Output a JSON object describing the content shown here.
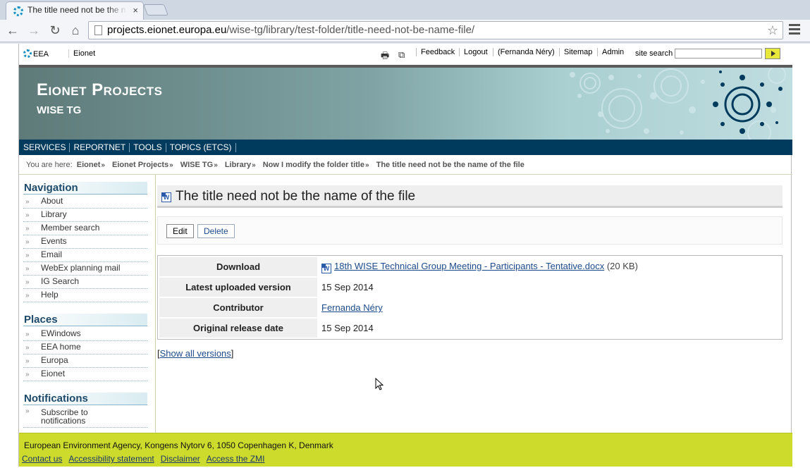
{
  "browser": {
    "tab_title": "The title need not be the n",
    "tab_close": "×",
    "url_host": "projects.eionet.europa.eu",
    "url_path": "/wise-tg/library/test-folder/title-need-not-be-name-file/",
    "back_glyph": "←",
    "forward_glyph": "→",
    "reload_glyph": "↻",
    "home_glyph": "⌂",
    "star_glyph": "☆"
  },
  "ribbon": {
    "eea": "EEA",
    "eionet": "Eionet",
    "print_glyph": "🖶",
    "fullscreen_glyph": "⧉",
    "feedback": "Feedback",
    "logout": "Logout",
    "user": "(Fernanda Néry)",
    "sitemap": "Sitemap",
    "admin": "Admin",
    "search_label": "site search"
  },
  "banner": {
    "title": "Eionet Projects",
    "subtitle": "WISE TG"
  },
  "mainnav": [
    "SERVICES",
    "REPORTNET",
    "TOOLS",
    "TOPICS (ETCS)"
  ],
  "breadcrumb": {
    "prefix": "You are here:",
    "items": [
      "Eionet",
      "Eionet Projects",
      "WISE TG",
      "Library",
      "Now I modify the folder title",
      "The title need not be the name of the file"
    ],
    "sep": "»"
  },
  "navigation": {
    "title": "Navigation",
    "items": [
      "About",
      "Library",
      "Member search",
      "Events",
      "Email",
      "WebEx planning mail",
      "IG Search",
      "Help"
    ]
  },
  "places": {
    "title": "Places",
    "items": [
      "EWindows",
      "EEA home",
      "Europa",
      "Eionet"
    ]
  },
  "notifications": {
    "title": "Notifications",
    "items": [
      "Subscribe to notifications"
    ]
  },
  "content": {
    "title": "The title need not be the name of the file",
    "icon_letter": "W",
    "edit_label": "Edit",
    "delete_label": "Delete",
    "rows": {
      "download_label": "Download",
      "download_file": "18th WISE Technical Group Meeting - Participants - Tentative.docx",
      "download_size": "(20 KB)",
      "latest_label": "Latest uploaded version",
      "latest_value": "15 Sep 2014",
      "contributor_label": "Contributor",
      "contributor_value": "Fernanda Néry",
      "release_label": "Original release date",
      "release_value": "15 Sep 2014"
    },
    "show_all": "Show all versions",
    "bracket_open": "[",
    "bracket_close": "]"
  },
  "footer": {
    "address": "European Environment Agency, Kongens Nytorv 6, 1050 Copenhagen K, Denmark",
    "links": [
      "Contact us",
      "Accessibility statement",
      "Disclaimer",
      "Access the ZMI"
    ]
  },
  "colors": {
    "nav_bar": "#003a5d",
    "footer": "#cddb2d",
    "link": "#1d4a8a",
    "portlet_heading": "#1d4a6a"
  }
}
